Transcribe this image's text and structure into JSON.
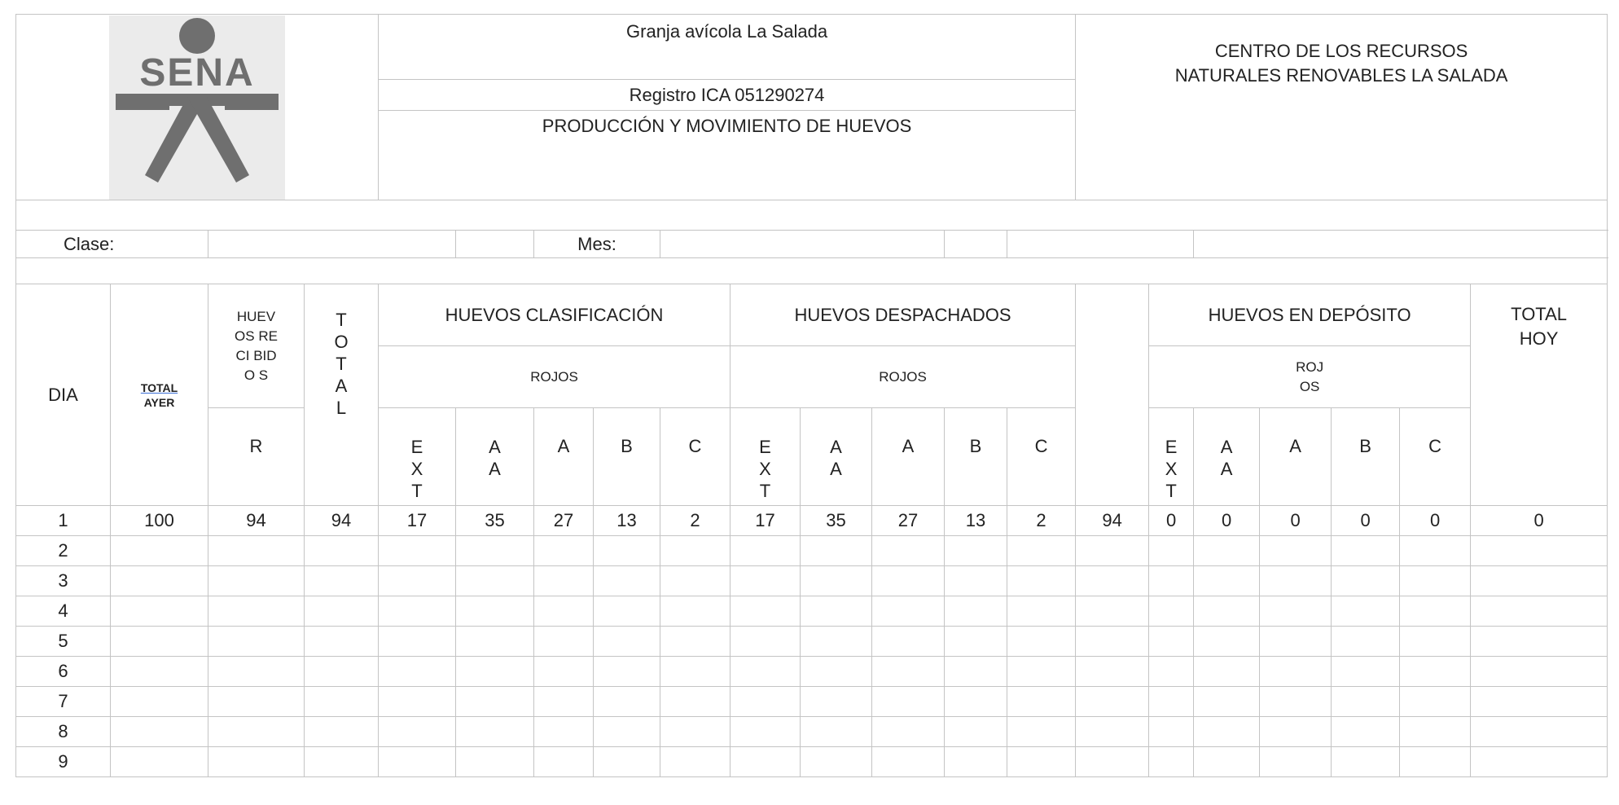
{
  "header": {
    "farm_name": "Granja avícola La Salada",
    "registro": "Registro ICA 051290274",
    "form_title": "PRODUCCIÓN Y MOVIMIENTO DE HUEVOS",
    "center_name": "CENTRO DE LOS RECURSOS NATURALES RENOVABLES LA SALADA",
    "logo_text": "SENA"
  },
  "fields": {
    "clase_label": "Clase:",
    "mes_label": "Mes:"
  },
  "columns": {
    "dia": "DIA",
    "total_ayer_top": "TOTAL",
    "total_ayer_bottom": "AYER",
    "huevos_recibidos": "HUEV OS RECI BIDO S",
    "recibidos_sub": "R",
    "total": "TOTAL",
    "clasificacion": "HUEVOS CLASIFICACIÓN",
    "despachados": "HUEVOS DESPACHADOS",
    "deposito": "HUEVOS EN DEPÓSITO",
    "rojos": "ROJOS",
    "rojos_split": "ROJ OS",
    "total_hoy": "TOTAL HOY",
    "ext": "EXT",
    "aa": "AA",
    "a": "A",
    "b": "B",
    "c": "C"
  },
  "rows": [
    [
      "1",
      "100",
      "94",
      "94",
      "17",
      "35",
      "27",
      "13",
      "2",
      "17",
      "35",
      "27",
      "13",
      "2",
      "94",
      "0",
      "0",
      "0",
      "0",
      "0",
      "0"
    ],
    [
      "2"
    ],
    [
      "3"
    ],
    [
      "4"
    ],
    [
      "5"
    ],
    [
      "6"
    ],
    [
      "7"
    ],
    [
      "8"
    ],
    [
      "9"
    ]
  ]
}
